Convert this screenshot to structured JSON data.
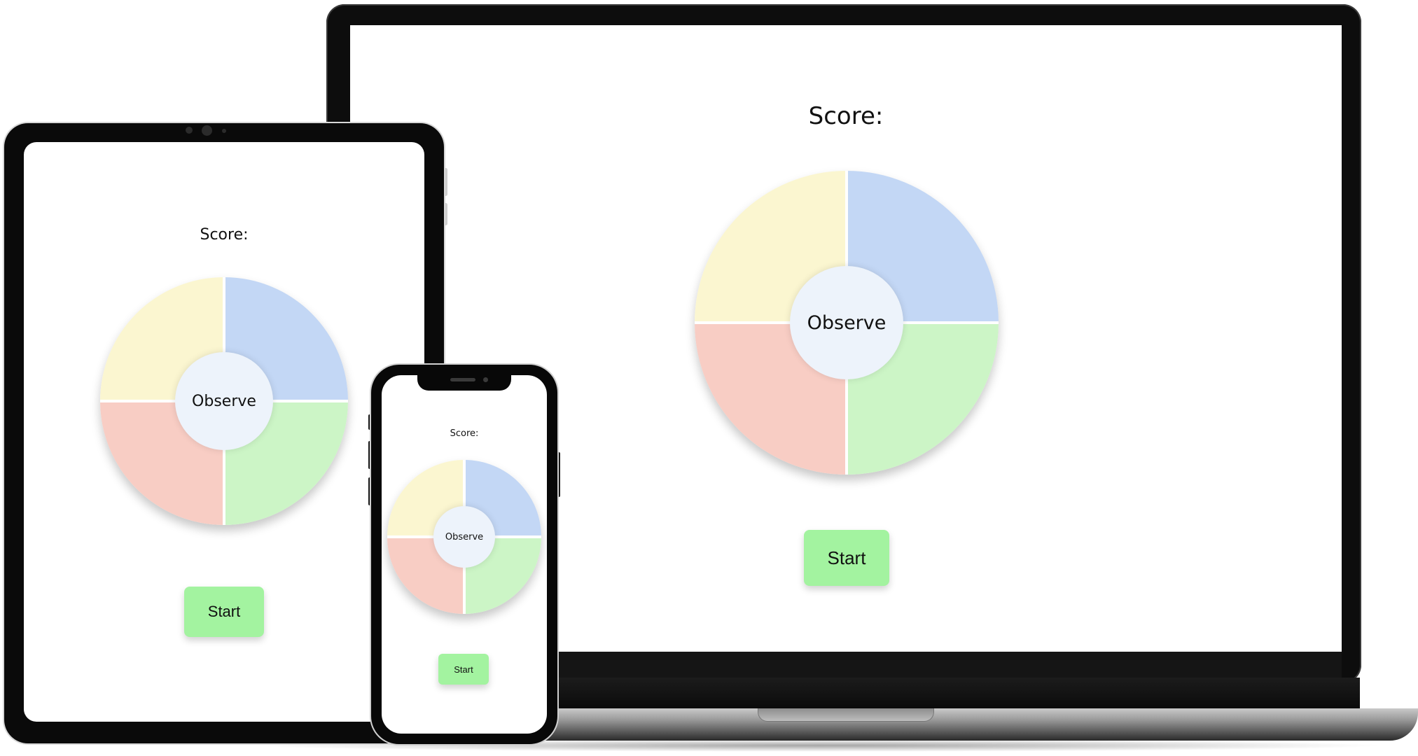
{
  "game": {
    "score_label": "Score:",
    "center_label": "Observe",
    "start_label": "Start",
    "colors": {
      "yellow": "#fbf6d0",
      "blue": "#c3d7f5",
      "red": "#f8cdc4",
      "green": "#ccf5c6",
      "center": "#edf3fb",
      "start_button": "#a3f3a0"
    }
  },
  "devices": [
    "laptop",
    "tablet",
    "phone"
  ]
}
